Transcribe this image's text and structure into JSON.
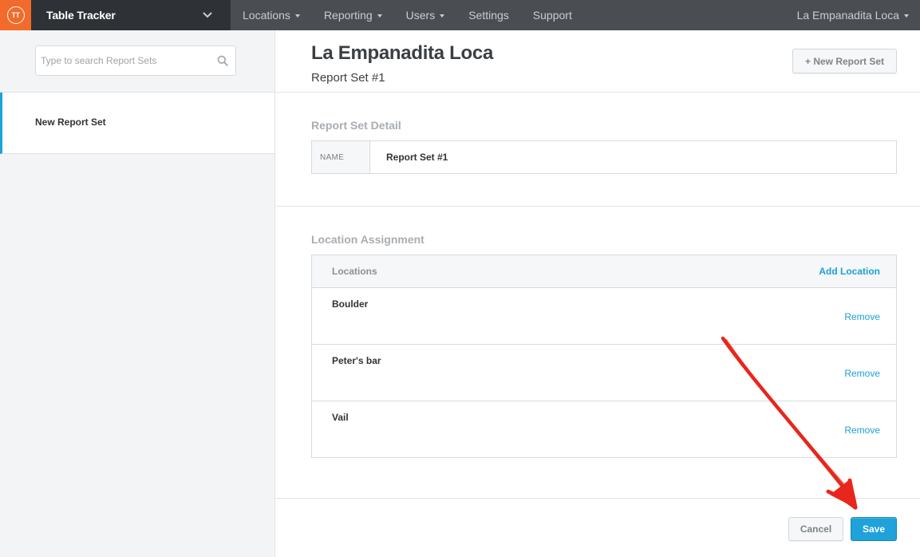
{
  "app": {
    "logo_text": "TT",
    "name": "Table Tracker"
  },
  "nav": {
    "items": [
      {
        "label": "Locations",
        "has_caret": true
      },
      {
        "label": "Reporting",
        "has_caret": true
      },
      {
        "label": "Users",
        "has_caret": true
      },
      {
        "label": "Settings",
        "has_caret": false
      },
      {
        "label": "Support",
        "has_caret": false
      }
    ],
    "account_label": "La Empanadita Loca"
  },
  "sidebar": {
    "search_placeholder": "Type to search Report Sets",
    "items": [
      {
        "label": "New Report Set",
        "active": true
      }
    ]
  },
  "header": {
    "title": "La Empanadita Loca",
    "subtitle": "Report Set #1",
    "new_button_label": "+ New Report Set"
  },
  "detail": {
    "section_title": "Report Set Detail",
    "name_label": "NAME",
    "name_value": "Report Set #1"
  },
  "locations": {
    "section_title": "Location Assignment",
    "column_label": "Locations",
    "add_label": "Add Location",
    "rows": [
      {
        "name": "Boulder",
        "action": "Remove"
      },
      {
        "name": "Peter's bar",
        "action": "Remove"
      },
      {
        "name": "Vail",
        "action": "Remove"
      }
    ]
  },
  "footer": {
    "cancel_label": "Cancel",
    "save_label": "Save"
  },
  "colors": {
    "brand_orange": "#f26b2a",
    "topbar": "#4a4e53",
    "accent_blue": "#1da1d6",
    "annotation_red": "#e8261c"
  },
  "icons": {
    "search": "search-icon",
    "app_switch": "chevron-down-icon"
  }
}
